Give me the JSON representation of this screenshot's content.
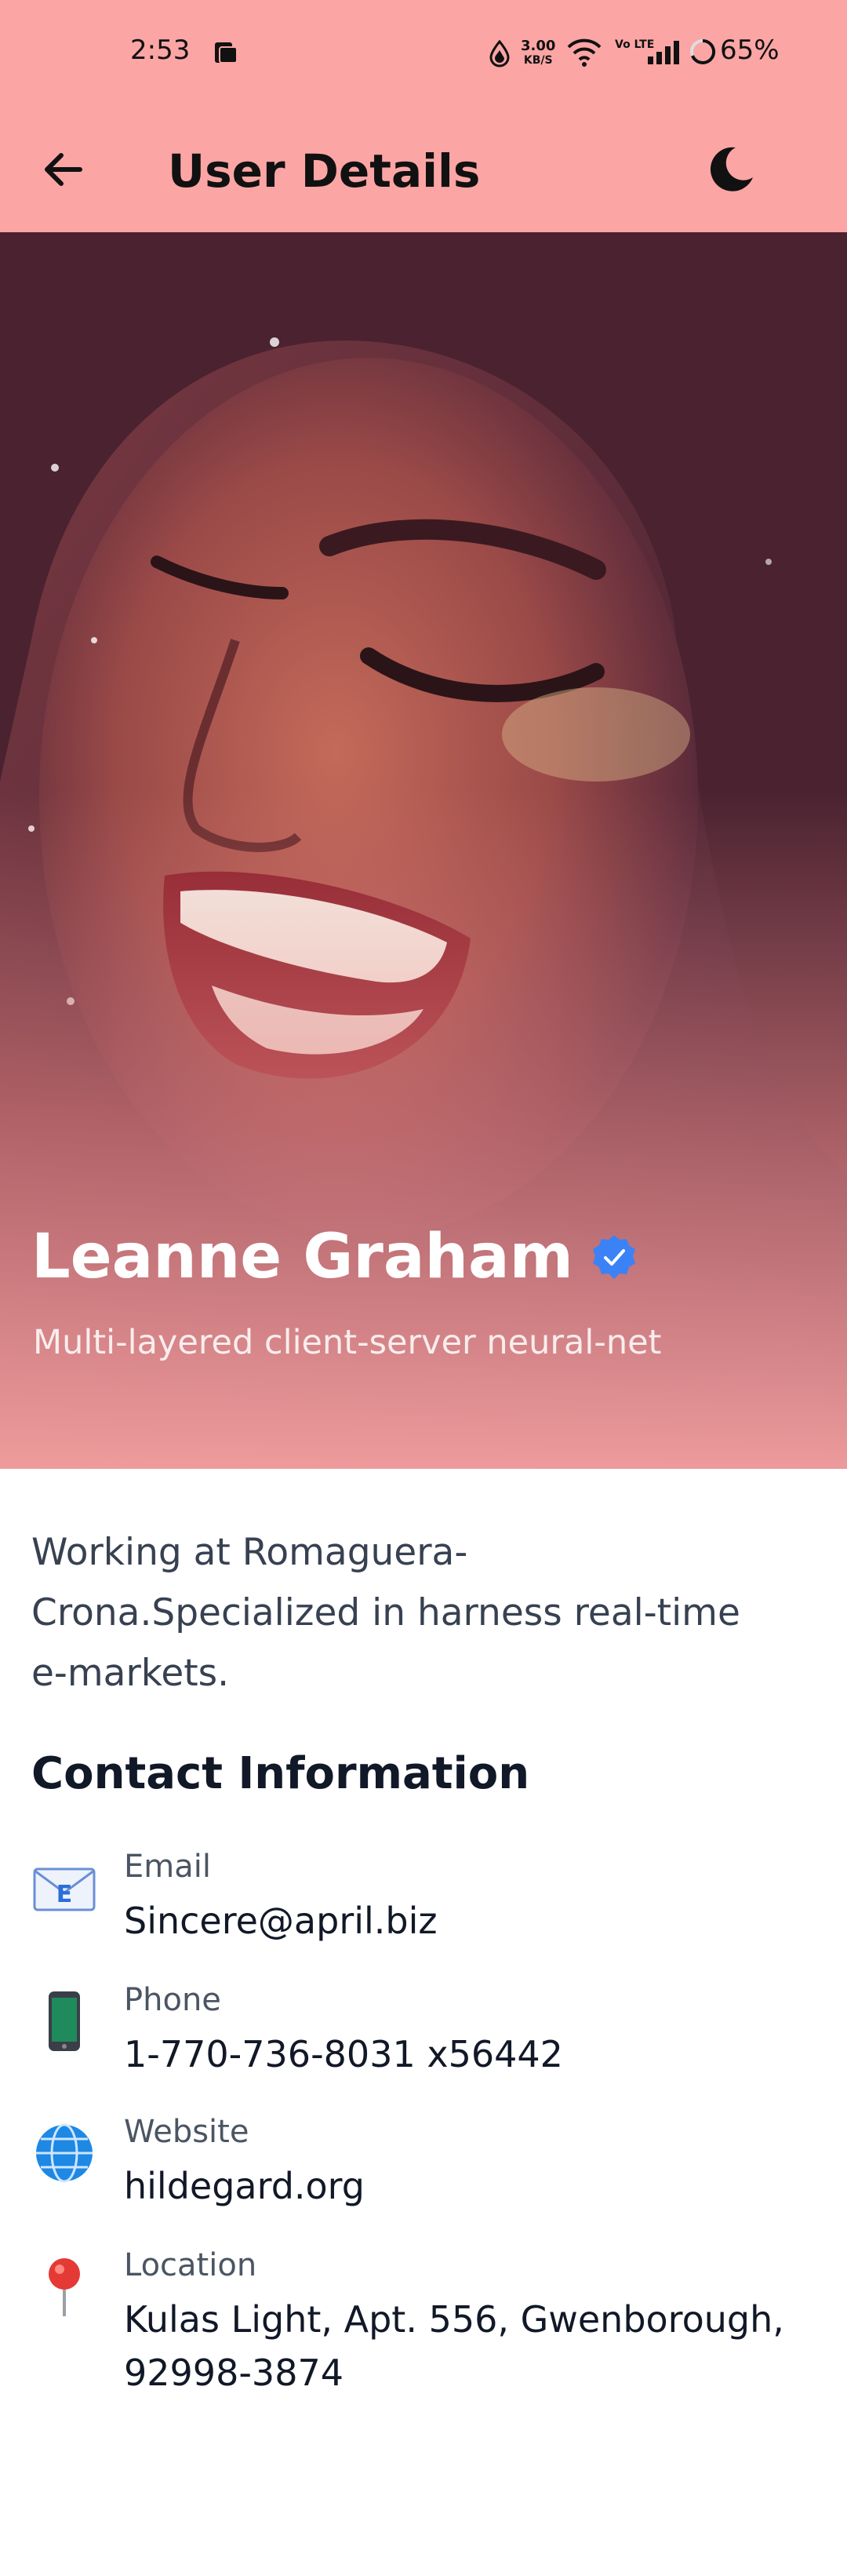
{
  "status_bar": {
    "time": "2:53",
    "net_speed_value": "3.00",
    "net_speed_unit": "KB/S",
    "volte": "Vo LTE",
    "battery": "65%"
  },
  "app_bar": {
    "title": "User Details",
    "back_icon": "arrow-left-icon",
    "theme_icon": "moon-icon"
  },
  "profile": {
    "name": "Leanne Graham",
    "tagline": "Multi-layered client-server neural-net",
    "verified_icon": "verified-check-icon",
    "about": "Working at Romaguera-Crona.Specialized in harness real-time e-markets."
  },
  "contact": {
    "section_title": "Contact Information",
    "items": [
      {
        "icon": "email-envelope-icon",
        "label": "Email",
        "value": "Sincere@april.biz"
      },
      {
        "icon": "mobile-phone-icon",
        "label": "Phone",
        "value": "1-770-736-8031 x56442"
      },
      {
        "icon": "globe-icon",
        "label": "Website",
        "value": "hildegard.org"
      },
      {
        "icon": "location-pin-icon",
        "label": "Location",
        "value": "Kulas Light, Apt. 556, Gwenborough, 92998-3874"
      }
    ]
  },
  "colors": {
    "app_bar": "#FCA5A5",
    "verified": "#3B82F6",
    "text_primary": "#111827",
    "text_secondary": "#4B5563"
  }
}
